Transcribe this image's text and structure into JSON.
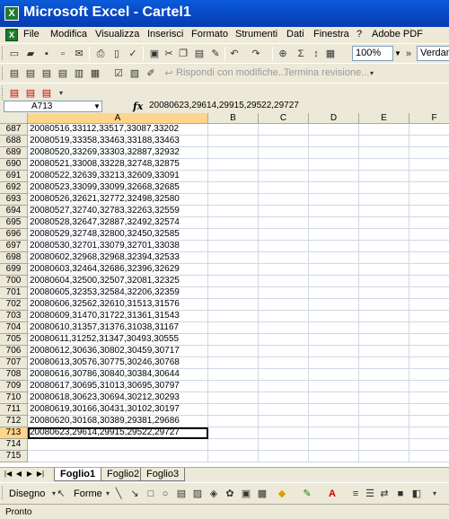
{
  "window": {
    "title": "Microsoft Excel - Cartel1",
    "app_icon": "excel-icon"
  },
  "menu": [
    "File",
    "Modifica",
    "Visualizza",
    "Inserisci",
    "Formato",
    "Strumenti",
    "Dati",
    "Finestra",
    "?",
    "Adobe PDF"
  ],
  "toolbar": {
    "zoom": "100%",
    "font": "Verdana",
    "reply_with_changes": "Rispondi con modifiche...",
    "end_review": "Termina revisione..."
  },
  "formula_bar": {
    "name_box": "A713",
    "fx": "fx",
    "formula": "20080623,29614,29915,29522,29727"
  },
  "columns": [
    "A",
    "B",
    "C",
    "D",
    "E",
    "F"
  ],
  "rows": [
    {
      "num": "687",
      "a": "20080516,33112,33517,33087,33202"
    },
    {
      "num": "688",
      "a": "20080519,33358,33463,33188,33463"
    },
    {
      "num": "689",
      "a": "20080520,33269,33303,32887,32932"
    },
    {
      "num": "690",
      "a": "20080521,33008,33228,32748,32875"
    },
    {
      "num": "691",
      "a": "20080522,32639,33213,32609,33091"
    },
    {
      "num": "692",
      "a": "20080523,33099,33099,32668,32685"
    },
    {
      "num": "693",
      "a": "20080526,32621,32772,32498,32580"
    },
    {
      "num": "694",
      "a": "20080527,32740,32783,32263,32559"
    },
    {
      "num": "695",
      "a": "20080528,32647,32887,32492,32574"
    },
    {
      "num": "696",
      "a": "20080529,32748,32800,32450,32585"
    },
    {
      "num": "697",
      "a": "20080530,32701,33079,32701,33038"
    },
    {
      "num": "698",
      "a": "20080602,32968,32968,32394,32533"
    },
    {
      "num": "699",
      "a": "20080603,32464,32686,32396,32629"
    },
    {
      "num": "700",
      "a": "20080604,32500,32507,32081,32325"
    },
    {
      "num": "701",
      "a": "20080605,32353,32584,32206,32359"
    },
    {
      "num": "702",
      "a": "20080606,32562,32610,31513,31576"
    },
    {
      "num": "703",
      "a": "20080609,31470,31722,31361,31543"
    },
    {
      "num": "704",
      "a": "20080610,31357,31376,31038,31167"
    },
    {
      "num": "705",
      "a": "20080611,31252,31347,30493,30555"
    },
    {
      "num": "706",
      "a": "20080612,30636,30802,30459,30717"
    },
    {
      "num": "707",
      "a": "20080613,30576,30775,30246,30768"
    },
    {
      "num": "708",
      "a": "20080616,30786,30840,30384,30644"
    },
    {
      "num": "709",
      "a": "20080617,30695,31013,30695,30797"
    },
    {
      "num": "710",
      "a": "20080618,30623,30694,30212,30293"
    },
    {
      "num": "711",
      "a": "20080619,30166,30431,30102,30197"
    },
    {
      "num": "712",
      "a": "20080620,30168,30389,29381,29686"
    },
    {
      "num": "713",
      "a": "20080623,29614,29915,29522,29727"
    },
    {
      "num": "714",
      "a": ""
    },
    {
      "num": "715",
      "a": ""
    }
  ],
  "active_row": "713",
  "sheets": [
    "Foglio1",
    "Foglio2",
    "Foglio3"
  ],
  "active_sheet": "Foglio1",
  "drawing": {
    "draw_label": "Disegno",
    "shapes_label": "Forme"
  },
  "status": "Pronto"
}
